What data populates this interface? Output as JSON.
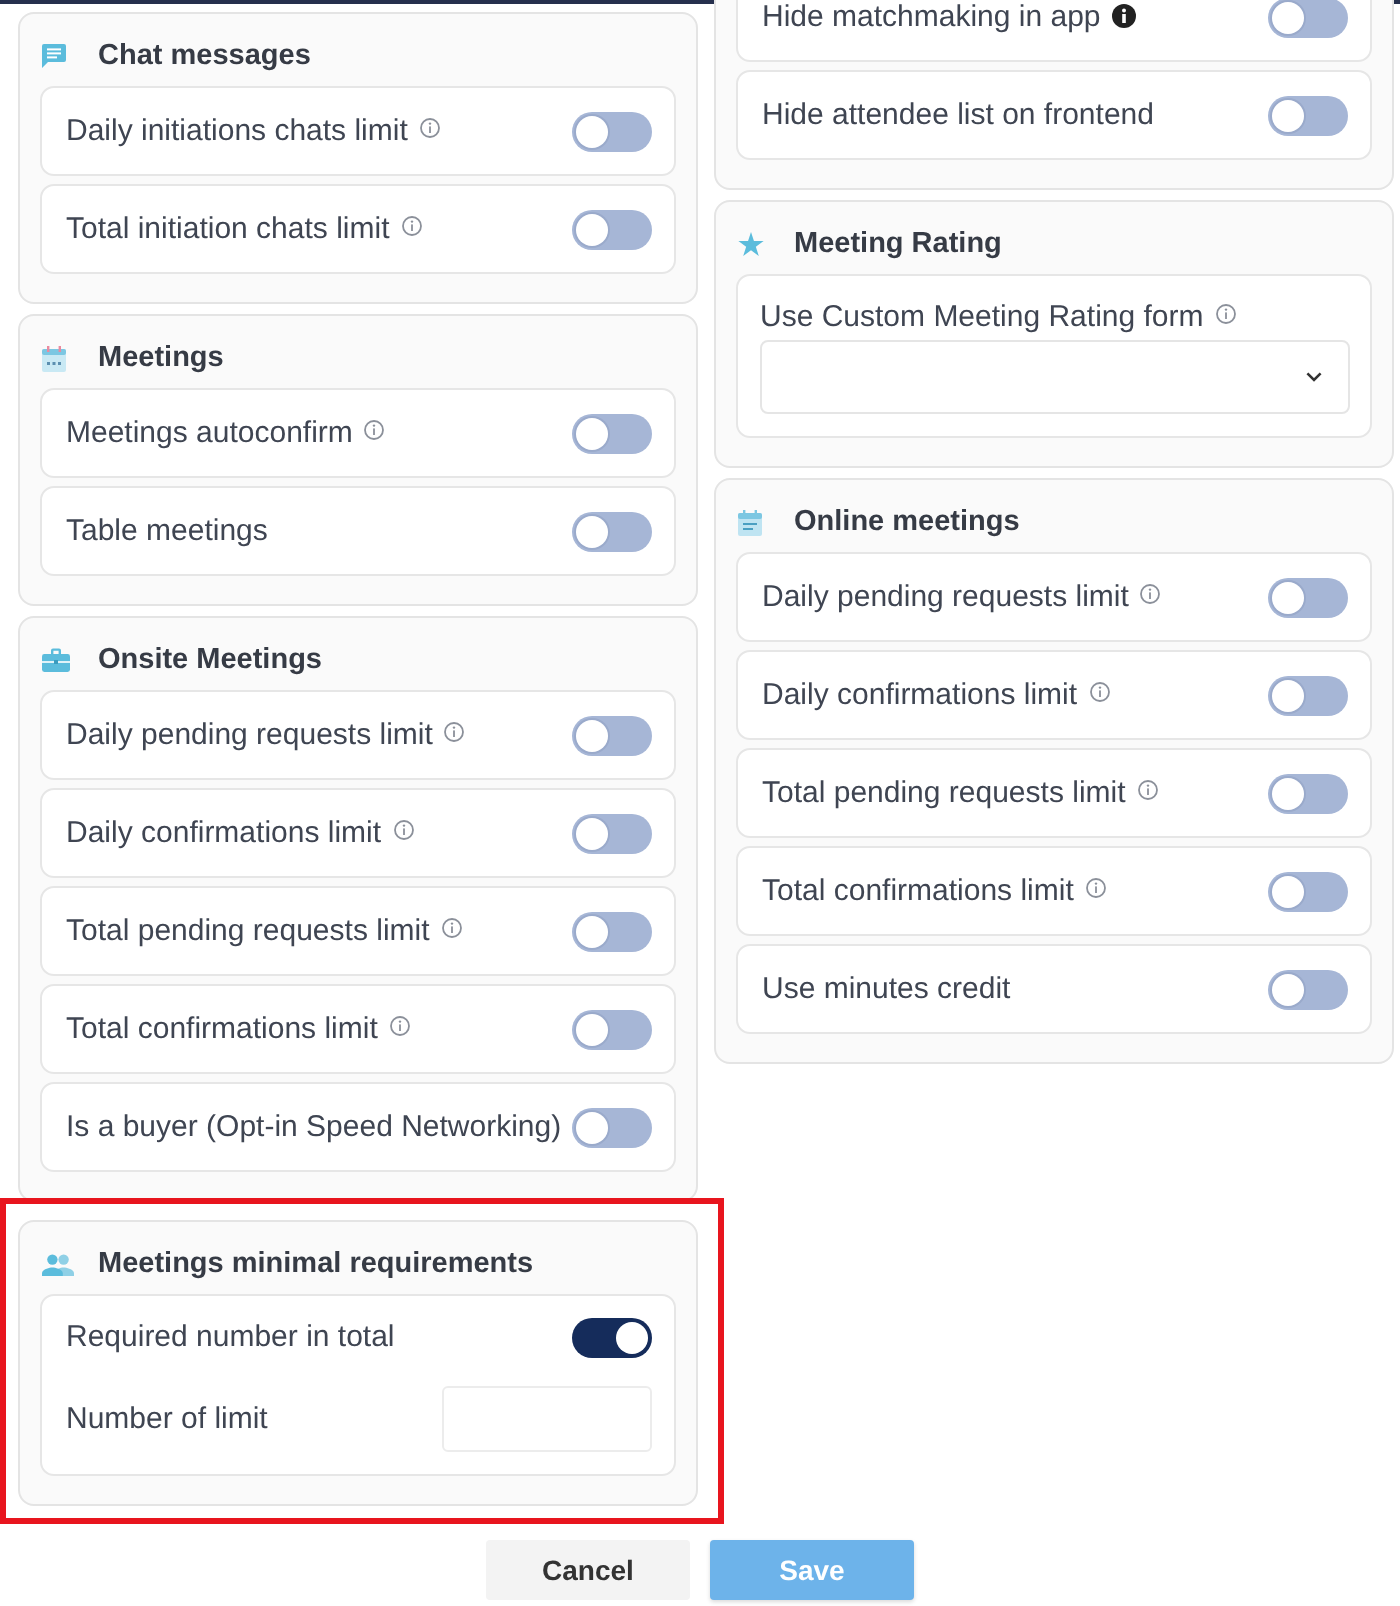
{
  "left_column": {
    "sections": [
      {
        "title": "Chat messages",
        "highlighted": false,
        "items": [
          {
            "kind": "toggle",
            "label": "Daily initiations chats limit",
            "info": true,
            "on": false
          },
          {
            "kind": "toggle",
            "label": "Total initiation chats limit",
            "info": true,
            "on": false
          }
        ]
      },
      {
        "title": "Meetings",
        "highlighted": false,
        "items": [
          {
            "kind": "toggle",
            "label": "Meetings autoconfirm",
            "info": true,
            "on": false
          },
          {
            "kind": "toggle",
            "label": "Table meetings",
            "on": false
          }
        ]
      },
      {
        "title": "Onsite Meetings",
        "highlighted": false,
        "items": [
          {
            "kind": "toggle",
            "label": "Daily pending requests limit",
            "info": true,
            "on": false
          },
          {
            "kind": "toggle",
            "label": "Daily confirmations limit",
            "info": true,
            "on": false
          },
          {
            "kind": "toggle",
            "label": "Total pending requests limit",
            "info": true,
            "on": false
          },
          {
            "kind": "toggle",
            "label": "Total confirmations limit",
            "info": true,
            "on": false
          },
          {
            "kind": "toggle",
            "label": "Is a buyer (Opt-in Speed Networking)",
            "on": false
          }
        ]
      },
      {
        "title": "Meetings minimal requirements",
        "highlighted": true,
        "items": [
          {
            "kind": "group",
            "fields": [
              {
                "kind": "toggle",
                "label": "Required number in total",
                "on": true
              },
              {
                "kind": "number",
                "label": "Number of limit"
              }
            ]
          }
        ]
      }
    ]
  },
  "right_column": {
    "sections": [
      {
        "highlighted": false,
        "items": [
          {
            "kind": "toggle",
            "label": "Hide matchmaking in app",
            "info": true,
            "info_filled": true,
            "on": false
          },
          {
            "kind": "toggle",
            "label": "Hide attendee list on frontend",
            "on": false
          }
        ]
      },
      {
        "title": "Meeting Rating",
        "highlighted": false,
        "items": [
          {
            "kind": "select",
            "label": "Use Custom Meeting Rating form",
            "info": true
          }
        ]
      },
      {
        "title": "Online meetings",
        "highlighted": false,
        "items": [
          {
            "kind": "toggle",
            "label": "Daily pending requests limit",
            "info": true,
            "on": false
          },
          {
            "kind": "toggle",
            "label": "Daily confirmations limit",
            "info": true,
            "on": false
          },
          {
            "kind": "toggle",
            "label": "Total pending requests limit",
            "info": true,
            "on": false
          },
          {
            "kind": "toggle",
            "label": "Total confirmations limit",
            "info": true,
            "on": false
          },
          {
            "kind": "toggle",
            "label": "Use minutes credit",
            "on": false
          }
        ]
      }
    ]
  },
  "buttons": [
    {
      "label": "Cancel",
      "kind": "secondary"
    },
    {
      "label": "Save",
      "kind": "primary"
    }
  ]
}
